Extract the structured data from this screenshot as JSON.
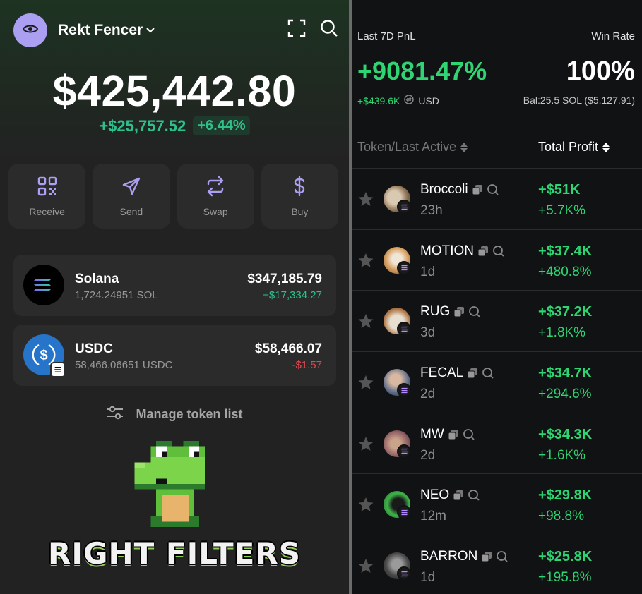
{
  "wallet": {
    "account_name": "Rekt Fencer",
    "balance": "$425,442.80",
    "change_usd": "+$25,757.52",
    "change_pct": "+6.44%",
    "actions": [
      {
        "label": "Receive",
        "icon": "qr-code-icon"
      },
      {
        "label": "Send",
        "icon": "send-icon"
      },
      {
        "label": "Swap",
        "icon": "swap-icon"
      },
      {
        "label": "Buy",
        "icon": "dollar-icon"
      }
    ],
    "tokens": [
      {
        "name": "Solana",
        "amount": "1,724.24951 SOL",
        "value": "$347,185.79",
        "change": "+$17,334.27",
        "change_color": "#2ec08b"
      },
      {
        "name": "USDC",
        "amount": "58,466.06651 USDC",
        "value": "$58,466.07",
        "change": "-$1.57",
        "change_color": "#e5484d"
      }
    ],
    "manage_label": "Manage token list",
    "accent_color": "#ab9ff2"
  },
  "overlay": {
    "caption": "RIGHT FILTERS"
  },
  "pnl": {
    "pnl_label": "Last 7D PnL",
    "winrate_label": "Win Rate",
    "pnl_value": "+9081.47%",
    "winrate_value": "100%",
    "pnl_usd": "+$439.6K",
    "pnl_currency": "USD",
    "balance": "Bal:25.5 SOL ($5,127.91)",
    "col_token": "Token/Last Active",
    "col_profit": "Total Profit",
    "rows": [
      {
        "name": "Broccoli",
        "time": "23h",
        "profit_usd": "+$51K",
        "profit_pct": "+5.7K%"
      },
      {
        "name": "MOTION",
        "time": "1d",
        "profit_usd": "+$37.4K",
        "profit_pct": "+480.8%"
      },
      {
        "name": "RUG",
        "time": "3d",
        "profit_usd": "+$37.2K",
        "profit_pct": "+1.8K%"
      },
      {
        "name": "FECAL",
        "time": "2d",
        "profit_usd": "+$34.7K",
        "profit_pct": "+294.6%"
      },
      {
        "name": "MW",
        "time": "2d",
        "profit_usd": "+$34.3K",
        "profit_pct": "+1.6K%"
      },
      {
        "name": "NEO",
        "time": "12m",
        "profit_usd": "+$29.8K",
        "profit_pct": "+98.8%"
      },
      {
        "name": "BARRON",
        "time": "1d",
        "profit_usd": "+$25.8K",
        "profit_pct": "+195.8%"
      }
    ],
    "positive_color": "#2ed572"
  }
}
